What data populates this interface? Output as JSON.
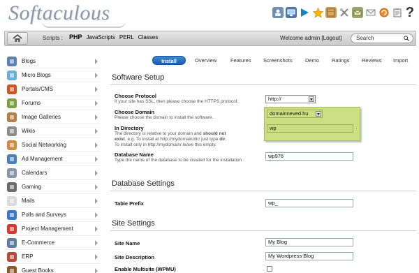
{
  "header": {
    "logo": "Softaculous",
    "icons": [
      "user-icon",
      "desktop-icon",
      "play-icon",
      "star-icon",
      "box-icon",
      "tools-icon",
      "mail-icon",
      "envelope-icon",
      "refresh-icon",
      "clipboard-icon",
      "help-icon"
    ],
    "help_glyph": "?"
  },
  "nav": {
    "scripts_label": "Scripts :",
    "scripts": [
      "PHP",
      "JavaScripts",
      "PERL",
      "Classes"
    ],
    "welcome": "Welcome admin [Logout]",
    "search_placeholder": "Search"
  },
  "sidebar": {
    "items": [
      {
        "label": "Blogs",
        "icon": "user-icon",
        "color": "#5a7fb0"
      },
      {
        "label": "Micro Blogs",
        "icon": "bird-icon",
        "color": "#6aaedb"
      },
      {
        "label": "Portals/CMS",
        "icon": "portal-icon",
        "color": "#cc5522"
      },
      {
        "label": "Forums",
        "icon": "forum-icon",
        "color": "#7aa040"
      },
      {
        "label": "Image Galleries",
        "icon": "image-icon",
        "color": "#b57e42"
      },
      {
        "label": "Wikis",
        "icon": "wiki-icon",
        "color": "#8c8c8c"
      },
      {
        "label": "Social Networking",
        "icon": "social-icon",
        "color": "#d08a3e"
      },
      {
        "label": "Ad Management",
        "icon": "ad-icon",
        "color": "#4b7fb5"
      },
      {
        "label": "Calendars",
        "icon": "calendar-icon",
        "color": "#8896a8"
      },
      {
        "label": "Gaming",
        "icon": "gamepad-icon",
        "color": "#6b6b6b"
      },
      {
        "label": "Mails",
        "icon": "mail-icon",
        "color": "#d9d9d9"
      },
      {
        "label": "Polls and Surveys",
        "icon": "pie-icon",
        "color": "#3a78c4"
      },
      {
        "label": "Project Management",
        "icon": "project-icon",
        "color": "#d53a2e"
      },
      {
        "label": "E-Commerce",
        "icon": "cart-icon",
        "color": "#5e7da0"
      },
      {
        "label": "ERP",
        "icon": "erp-icon",
        "color": "#b64a3a"
      },
      {
        "label": "Guest Books",
        "icon": "book-icon",
        "color": "#8b5a2b"
      }
    ]
  },
  "tabs": [
    "Install",
    "Overview",
    "Features",
    "Screenshots",
    "Demo",
    "Ratings",
    "Reviews",
    "Import"
  ],
  "software_setup": {
    "title": "Software Setup",
    "protocol": {
      "label": "Choose Protocol",
      "desc": "If your site has SSL, then please choose the HTTPS protocol.",
      "value": "http://"
    },
    "domain": {
      "label": "Choose Domain",
      "desc": "Please choose the domain to install the software.",
      "value": "domainneved.hu"
    },
    "directory": {
      "label": "In Directory",
      "desc_1": "The directory is relative to your domain and",
      "desc_1_bold": "should not",
      "desc_2_bold": "exist",
      "desc_2": ". e.g. To install at http://mydomain/dir/ just type",
      "desc_2_tail_bold": "dir",
      "desc_3": "To install only in http://mydomain/ leave this empty.",
      "value": "wp"
    },
    "database": {
      "label": "Database Name",
      "desc": "Type the name of the database to be created for the installation",
      "value": "wp976"
    }
  },
  "database_settings": {
    "title": "Database Settings",
    "table_prefix": {
      "label": "Table Prefix",
      "value": "wp_"
    }
  },
  "site_settings": {
    "title": "Site Settings",
    "site_name": {
      "label": "Site Name",
      "value": "My Blog"
    },
    "site_description": {
      "label": "Site Description",
      "value": "My Wordpress Blog"
    },
    "multisite": {
      "label": "Enable Multisite (WPMU)"
    }
  }
}
